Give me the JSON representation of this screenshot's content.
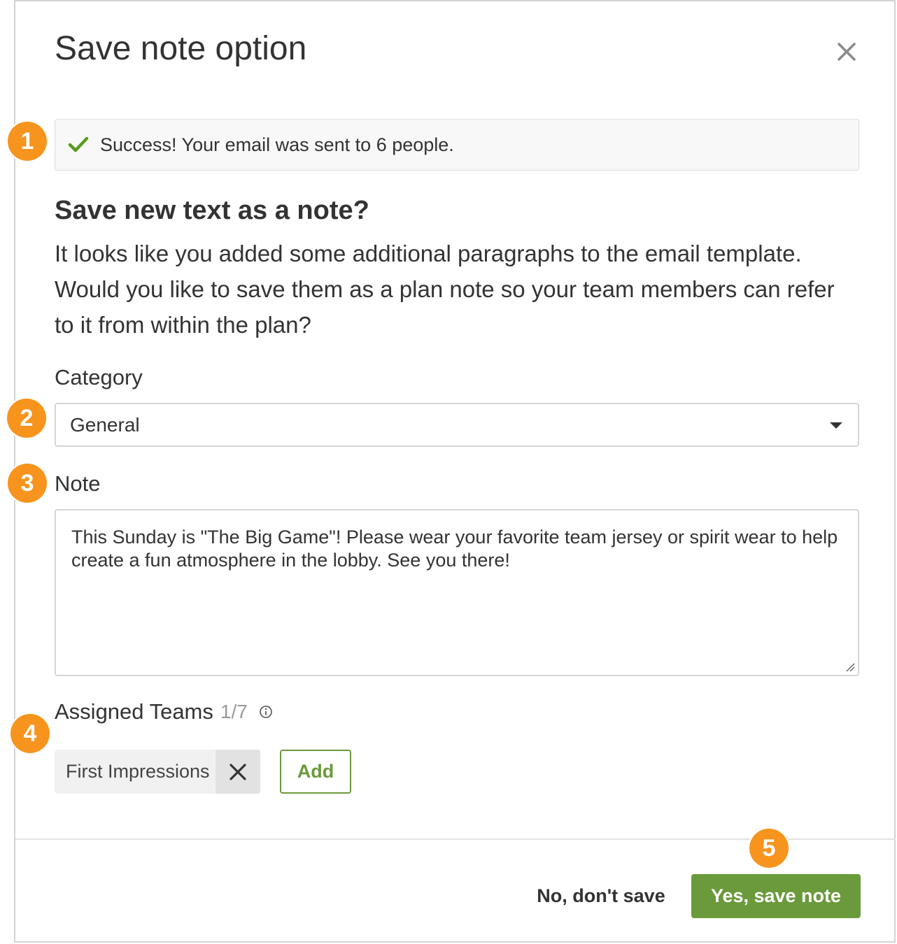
{
  "dialog": {
    "title": "Save note option",
    "close_icon": "close-icon"
  },
  "alert": {
    "icon": "checkmark-icon",
    "icon_color": "#5a9a1e",
    "message": "Success! Your email was sent to 6 people."
  },
  "prompt": {
    "heading": "Save new text as a note?",
    "description": "It looks like you added some additional paragraphs to the email template. Would you like to save them as a plan note so your team members can refer to it from within the plan?"
  },
  "category": {
    "label": "Category",
    "selected": "General",
    "icon": "caret-down-icon"
  },
  "note": {
    "label": "Note",
    "value": "This Sunday is \"The Big Game\"! Please wear your favorite team jersey or spirit wear to help create a fun atmosphere in the lobby. See you there!"
  },
  "teams": {
    "label": "Assigned Teams",
    "count": "1/7",
    "info_icon": "info-icon",
    "chips": [
      {
        "label": "First Impressions",
        "remove_icon": "close-icon"
      }
    ],
    "add_label": "Add"
  },
  "footer": {
    "cancel_label": "No, don't save",
    "confirm_label": "Yes, save note"
  },
  "annotations": [
    "1",
    "2",
    "3",
    "4",
    "5"
  ],
  "colors": {
    "accent": "#6a9a3b",
    "badge": "#f7941d",
    "text": "#333333",
    "border": "#d6d6d6"
  }
}
